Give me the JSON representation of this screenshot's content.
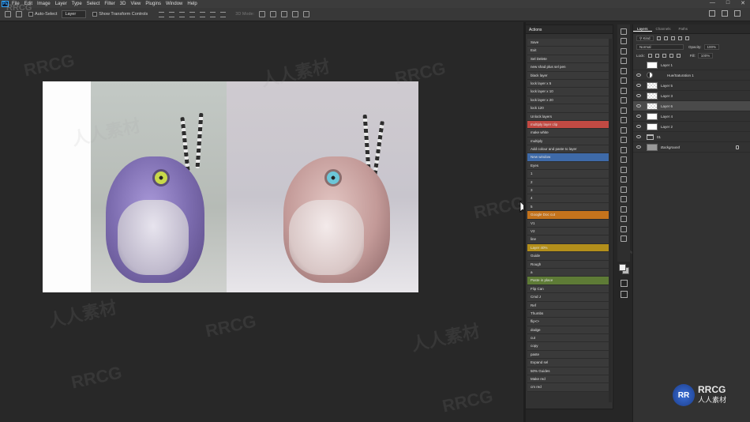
{
  "menubar": {
    "logo": "Ps",
    "items": [
      "File",
      "Edit",
      "Image",
      "Layer",
      "Type",
      "Select",
      "Filter",
      "3D",
      "View",
      "Plugins",
      "Window",
      "Help"
    ]
  },
  "options_bar": {
    "auto_select_label": "Auto-Select",
    "auto_select_target": "Layer",
    "transform_controls_label": "Show Transform Controls",
    "mode_3d_label": "3D Mode:"
  },
  "actions_panel": {
    "title": "Actions",
    "items": [
      {
        "label": "Save",
        "color": "#3a3a3a"
      },
      {
        "label": "Exit",
        "color": "#3a3a3a"
      },
      {
        "label": "Sel Delete",
        "color": "#3a3a3a"
      },
      {
        "label": "new shad plus sel pen",
        "color": "#3a3a3a"
      },
      {
        "label": "black layer",
        "color": "#3a3a3a"
      },
      {
        "label": "lock layer x 5",
        "color": "#3a3a3a"
      },
      {
        "label": "lock layer x 10",
        "color": "#3a3a3a"
      },
      {
        "label": "lock layer x 20",
        "color": "#3a3a3a"
      },
      {
        "label": "lock 120",
        "color": "#3a3a3a"
      },
      {
        "label": "Unlock layers",
        "color": "#3a3a3a"
      },
      {
        "label": "multiply layer clip",
        "color": "#c24a43"
      },
      {
        "label": "make white",
        "color": "#3a3a3a"
      },
      {
        "label": "multiply",
        "color": "#3a3a3a"
      },
      {
        "label": "Add colour and paste to layer",
        "color": "#3a3a3a"
      },
      {
        "label": "New window",
        "color": "#3e6aa8"
      },
      {
        "label": "Eyes",
        "color": "#3a3a3a"
      },
      {
        "label": "1",
        "color": "#3a3a3a"
      },
      {
        "label": "2",
        "color": "#3a3a3a"
      },
      {
        "label": "3",
        "color": "#3a3a3a"
      },
      {
        "label": "4",
        "color": "#3a3a3a"
      },
      {
        "label": "5",
        "color": "#3a3a3a"
      },
      {
        "label": "Google Doc cut",
        "color": "#c4731c"
      },
      {
        "label": "V1",
        "color": "#3a3a3a"
      },
      {
        "label": "V2",
        "color": "#3a3a3a"
      },
      {
        "label": "line",
        "color": "#3a3a3a"
      },
      {
        "label": "Layer 40%",
        "color": "#b38f1b"
      },
      {
        "label": "Guide",
        "color": "#3a3a3a"
      },
      {
        "label": "Rough",
        "color": "#3a3a3a"
      },
      {
        "label": "a",
        "color": "#3a3a3a"
      },
      {
        "label": "Paste in place",
        "color": "#5e7b36"
      },
      {
        "label": "Flip Can",
        "color": "#3a3a3a"
      },
      {
        "label": "Cmd J",
        "color": "#3a3a3a"
      },
      {
        "label": "Ref",
        "color": "#3a3a3a"
      },
      {
        "label": "Thumbs",
        "color": "#3a3a3a"
      },
      {
        "label": "flip<>",
        "color": "#3a3a3a"
      },
      {
        "label": "dodge",
        "color": "#3a3a3a"
      },
      {
        "label": "cut",
        "color": "#3a3a3a"
      },
      {
        "label": "copy",
        "color": "#3a3a3a"
      },
      {
        "label": "paste",
        "color": "#3a3a3a"
      },
      {
        "label": "Expand sel",
        "color": "#3a3a3a"
      },
      {
        "label": "50% Guides",
        "color": "#3a3a3a"
      },
      {
        "label": "Make red",
        "color": "#3a3a3a"
      },
      {
        "label": "cm red",
        "color": "#3a3a3a"
      }
    ]
  },
  "layers_panel": {
    "tabs": [
      "Layers",
      "Channels",
      "Paths"
    ],
    "active_tab": "Layers",
    "filter_label": "Kind",
    "blend_mode": "Normal",
    "opacity_label": "Opacity:",
    "opacity_value": "100%",
    "lock_label": "Lock:",
    "fill_label": "Fill:",
    "fill_value": "100%",
    "layers": [
      {
        "name": "Layer 1",
        "thumb": "white",
        "visible": false
      },
      {
        "name": "Hue/Saturation 1",
        "thumb": "adjust",
        "visible": true
      },
      {
        "name": "Layer 5",
        "thumb": "check",
        "visible": true
      },
      {
        "name": "Layer 3",
        "thumb": "check",
        "visible": true
      },
      {
        "name": "Layer 6",
        "thumb": "check",
        "visible": true,
        "selected": true
      },
      {
        "name": "Layer 4",
        "thumb": "white",
        "visible": true
      },
      {
        "name": "Layer 2",
        "thumb": "white",
        "visible": true
      },
      {
        "name": "01",
        "thumb": "folder",
        "visible": true
      },
      {
        "name": "Background",
        "thumb": "gray",
        "visible": true,
        "locked": true
      }
    ]
  },
  "watermark": {
    "latin": "RRCG",
    "cjk": "人人素材"
  },
  "logo": {
    "badge": "RR",
    "title": "RRCG",
    "subtitle": "人人素材"
  }
}
